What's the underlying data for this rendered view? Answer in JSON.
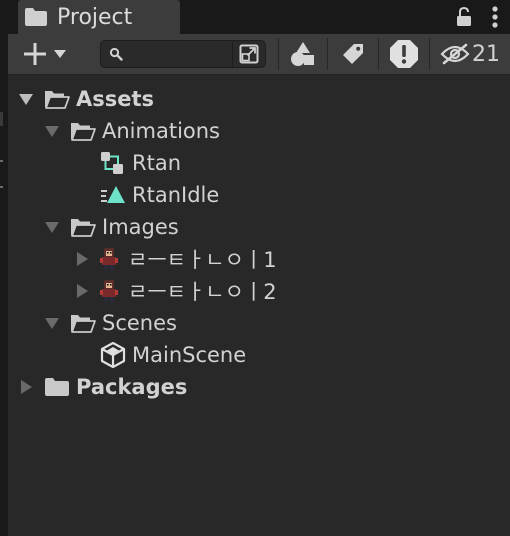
{
  "window": {
    "tab_title": "Project",
    "hidden_count": "21"
  },
  "search": {
    "value": "",
    "placeholder": ""
  },
  "tree": {
    "assets": "Assets",
    "animations": "Animations",
    "rtan": "Rtan",
    "rtan_idle": "RtanIdle",
    "images": "Images",
    "image1": "ㄹㅡㅌㅏㄴㅇㅣ1",
    "image2": "ㄹㅡㅌㅏㄴㅇㅣ2",
    "scenes": "Scenes",
    "main_scene": "MainScene",
    "packages": "Packages"
  },
  "colors": {
    "background": "#282828",
    "toolbar": "#3c3c3c",
    "tabbar": "#191919",
    "text": "#d2d2d2",
    "anim_clip_accent": "#6fe3c8",
    "controller_accent": "#6fe3c8"
  },
  "icons": {
    "tab": "folder-icon",
    "lock": "lock-icon",
    "menu": "kebab-menu-icon",
    "create": "plus-icon",
    "search": "search-icon",
    "search_type": "search-by-type-icon",
    "filter_type": "filter-by-type-icon",
    "filter_label": "filter-by-label-icon",
    "filter_warning": "warning-icon",
    "hidden_packages": "eye-slash-icon",
    "folder_open": "folder-open-icon",
    "folder_closed": "folder-closed-icon",
    "animator_controller": "animator-controller-icon",
    "animation_clip": "animation-clip-icon",
    "sprite": "sprite-icon",
    "scene": "unity-scene-icon"
  }
}
